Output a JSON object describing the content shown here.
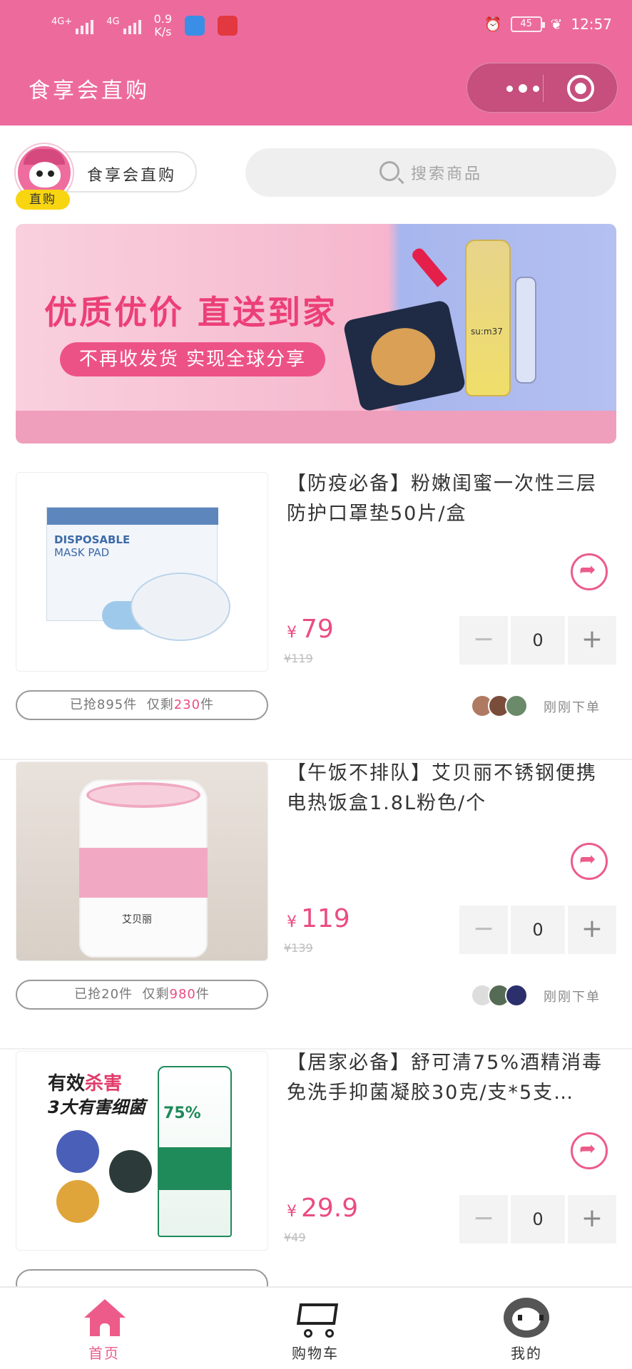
{
  "status_bar": {
    "net1": "4G+",
    "net2": "4G",
    "speed_value": "0.9",
    "speed_unit": "K/s",
    "battery": "45",
    "time": "12:57"
  },
  "header": {
    "title": "食享会直购"
  },
  "shop": {
    "name": "食享会直购",
    "tag": "直购"
  },
  "search": {
    "placeholder": "搜索商品"
  },
  "banner": {
    "headline": "优质优价 直送到家",
    "subline": "不再收发货 实现全球分享",
    "bottle_text": "su:m37"
  },
  "products": [
    {
      "name": "【防疫必备】粉嫩闺蜜一次性三层防护口罩垫50片/盒",
      "currency": "¥",
      "price": "79",
      "original_price": "¥119",
      "quantity": "0",
      "sold_prefix": "已抢",
      "sold": "895",
      "sold_unit": "件",
      "remain_prefix": "仅剩",
      "remain": "230",
      "remain_unit": "件",
      "recent": "刚刚下单",
      "img_text_1": "DISPOSABLE",
      "img_text_2": "MASK PAD"
    },
    {
      "name": "【午饭不排队】艾贝丽不锈钢便携电热饭盒1.8L粉色/个",
      "currency": "¥",
      "price": "119",
      "original_price": "¥139",
      "quantity": "0",
      "sold_prefix": "已抢",
      "sold": "20",
      "sold_unit": "件",
      "remain_prefix": "仅剩",
      "remain": "980",
      "remain_unit": "件",
      "recent": "刚刚下单",
      "img_text_1": "艾贝丽"
    },
    {
      "name": "【居家必备】舒可清75%酒精消毒免洗手抑菌凝胶30克/支*5支…",
      "currency": "¥",
      "price": "29.9",
      "original_price": "¥49",
      "quantity": "0",
      "img_text_1a": "有效",
      "img_text_1b": "杀害",
      "img_text_2": "3大有害细菌",
      "img_text_3": "75%"
    }
  ],
  "tabs": [
    {
      "label": "首页",
      "icon": "home-icon",
      "active": true
    },
    {
      "label": "购物车",
      "icon": "cart-icon",
      "active": false
    },
    {
      "label": "我的",
      "icon": "profile-icon",
      "active": false
    }
  ],
  "colors": {
    "brand": "#ec6b9c",
    "price": "#ec4c80",
    "tag": "#f8d511"
  }
}
